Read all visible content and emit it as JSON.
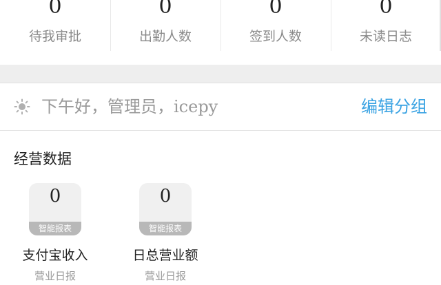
{
  "stats": [
    {
      "value": "0",
      "label": "待我审批"
    },
    {
      "value": "0",
      "label": "出勤人数"
    },
    {
      "value": "0",
      "label": "签到人数"
    },
    {
      "value": "0",
      "label": "未读日志"
    }
  ],
  "greeting": {
    "icon": "sun-icon",
    "text": "下午好，管理员，",
    "name": "icepy",
    "edit_label": "编辑分组",
    "edit_color": "#3aa3e3"
  },
  "business": {
    "title": "经营数据",
    "cards": [
      {
        "value": "0",
        "tag": "智能报表",
        "name": "支付宝收入",
        "sub": "营业日报"
      },
      {
        "value": "0",
        "tag": "智能报表",
        "name": "日总营业额",
        "sub": "营业日报"
      }
    ]
  }
}
